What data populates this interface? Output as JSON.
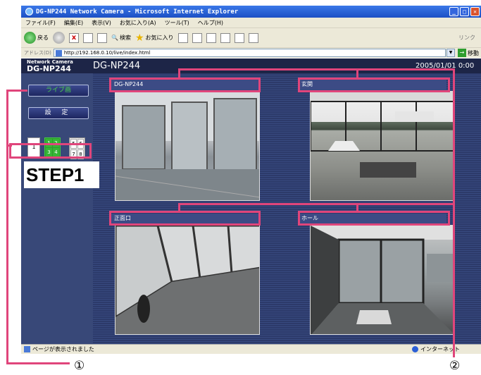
{
  "window": {
    "title": "DG-NP244 Network Camera - Microsoft Internet Explorer"
  },
  "menu": [
    "ファイル(F)",
    "編集(E)",
    "表示(V)",
    "お気に入り(A)",
    "ツール(T)",
    "ヘルプ(H)"
  ],
  "toolbar": {
    "back": "戻る",
    "search": "検索",
    "favorites": "お気に入り",
    "links": "リンク"
  },
  "address": {
    "label": "アドレス(D)",
    "url": "http://192.168.0.10/live/index.html",
    "go": "移動"
  },
  "page": {
    "brand_small": "Network Camera",
    "brand_big": "DG-NP244",
    "title": "DG-NP244",
    "clock": "2005/01/01  0:00",
    "live_button": "ライブ画",
    "setup_button": "設 定",
    "split_one": "1",
    "split_quad1": [
      "1",
      "2",
      "3",
      "4"
    ],
    "split_quad2": [
      "5",
      "6",
      "7",
      "8"
    ]
  },
  "cameras": [
    {
      "label": "DG-NP244"
    },
    {
      "label": "玄関"
    },
    {
      "label": "正面口"
    },
    {
      "label": "ホール"
    }
  ],
  "status": {
    "text": "ページが表示されました",
    "zone": "インターネット"
  },
  "annotations": {
    "step": "STEP1",
    "num1": "①",
    "num2": "②"
  },
  "colors": {
    "callout": "#e0457b",
    "page_bg": "#2c3a6a",
    "live_text": "#4dd04d"
  }
}
